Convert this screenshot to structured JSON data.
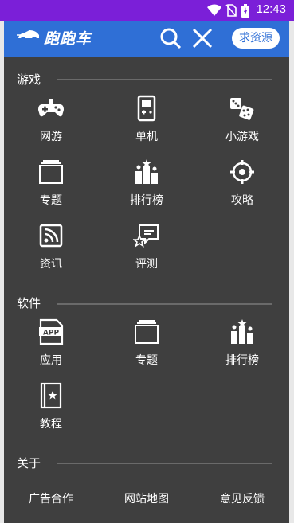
{
  "status": {
    "time": "12:43"
  },
  "header": {
    "logo_text": "跑跑车",
    "request_button": "求资源"
  },
  "sections": {
    "games": {
      "title": "游戏",
      "items": [
        {
          "label": "网游",
          "icon": "gamepad-icon"
        },
        {
          "label": "单机",
          "icon": "handheld-icon"
        },
        {
          "label": "小游戏",
          "icon": "dice-icon"
        },
        {
          "label": "专题",
          "icon": "folder-icon"
        },
        {
          "label": "排行榜",
          "icon": "ranking-icon"
        },
        {
          "label": "攻略",
          "icon": "refresh-icon"
        },
        {
          "label": "资讯",
          "icon": "rss-icon"
        },
        {
          "label": "评测",
          "icon": "review-icon"
        }
      ]
    },
    "software": {
      "title": "软件",
      "items": [
        {
          "label": "应用",
          "icon": "app-icon"
        },
        {
          "label": "专题",
          "icon": "folder-icon"
        },
        {
          "label": "排行榜",
          "icon": "ranking-icon"
        },
        {
          "label": "教程",
          "icon": "book-icon"
        }
      ]
    },
    "about": {
      "title": "关于",
      "links": [
        "广告合作",
        "网站地图",
        "意见反馈"
      ]
    }
  }
}
